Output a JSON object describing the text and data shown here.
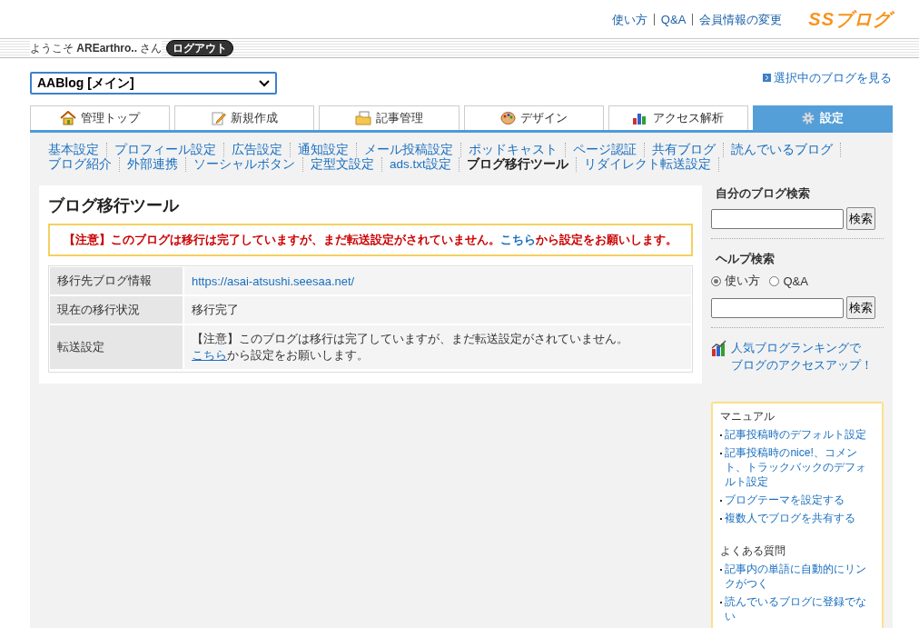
{
  "header": {
    "links": [
      "使い方",
      "Q&A",
      "会員情報の変更"
    ],
    "logo": "SSブログ"
  },
  "welcome": {
    "prefix": "ようこそ",
    "user": "AREarthro..",
    "suffix": "さん",
    "logout": "ログアウト"
  },
  "blog_select": {
    "value": "AABlog [メイン]"
  },
  "view_blog_link": "選択中のブログを見る",
  "tabs": [
    {
      "label": "管理トップ",
      "selected": false
    },
    {
      "label": "新規作成",
      "selected": false
    },
    {
      "label": "記事管理",
      "selected": false
    },
    {
      "label": "デザイン",
      "selected": false
    },
    {
      "label": "アクセス解析",
      "selected": false
    },
    {
      "label": "設定",
      "selected": true
    }
  ],
  "subnav": [
    [
      {
        "label": "基本設定",
        "selected": false
      },
      {
        "label": "プロフィール設定",
        "selected": false
      },
      {
        "label": "広告設定",
        "selected": false
      },
      {
        "label": "通知設定",
        "selected": false
      },
      {
        "label": "メール投稿設定",
        "selected": false
      },
      {
        "label": "ポッドキャスト",
        "selected": false
      },
      {
        "label": "ページ認証",
        "selected": false
      },
      {
        "label": "共有ブログ",
        "selected": false
      },
      {
        "label": "読んでいるブログ",
        "selected": false
      }
    ],
    [
      {
        "label": "ブログ紹介",
        "selected": false
      },
      {
        "label": "外部連携",
        "selected": false
      },
      {
        "label": "ソーシャルボタン",
        "selected": false
      },
      {
        "label": "定型文設定",
        "selected": false
      },
      {
        "label": "ads.txt設定",
        "selected": false
      },
      {
        "label": "ブログ移行ツール",
        "selected": true
      },
      {
        "label": "リダイレクト転送設定",
        "selected": false
      }
    ]
  ],
  "main": {
    "title": "ブログ移行ツール",
    "notice": {
      "text": "【注意】このブログは移行は完了していますが、まだ転送設定がされていません。",
      "link": "こちら",
      "after": "から設定をお願いします。"
    },
    "rows": [
      {
        "label": "移行先ブログ情報",
        "kind": "link",
        "value": "https://asai-atsushi.seesaa.net/"
      },
      {
        "label": "現在の移行状況",
        "kind": "text",
        "value": "移行完了"
      },
      {
        "label": "転送設定",
        "kind": "notice",
        "value": "【注意】このブログは移行は完了していますが、まだ転送設定がされていません。",
        "link": "こちら",
        "after": "から設定をお願いします。"
      }
    ]
  },
  "sidebar": {
    "blog_search": {
      "title": "自分のブログ検索",
      "button": "検索"
    },
    "help_search": {
      "title": "ヘルプ検索",
      "options": [
        {
          "label": "使い方",
          "selected": true
        },
        {
          "label": "Q&A",
          "selected": false
        }
      ],
      "button": "検索"
    },
    "ranking_link": [
      "人気ブログランキングで",
      "ブログのアクセスアップ！"
    ],
    "manual": {
      "title": "マニュアル",
      "items": [
        "記事投稿時のデフォルト設定",
        "記事投稿時のnice!、コメント、トラックバックのデフォルト設定",
        "ブログテーマを設定する",
        "複数人でブログを共有する"
      ]
    },
    "faq": {
      "title": "よくある質問",
      "items": [
        "記事内の単語に自動的にリンクがつく",
        "読んでいるブログに登録でない"
      ]
    }
  }
}
